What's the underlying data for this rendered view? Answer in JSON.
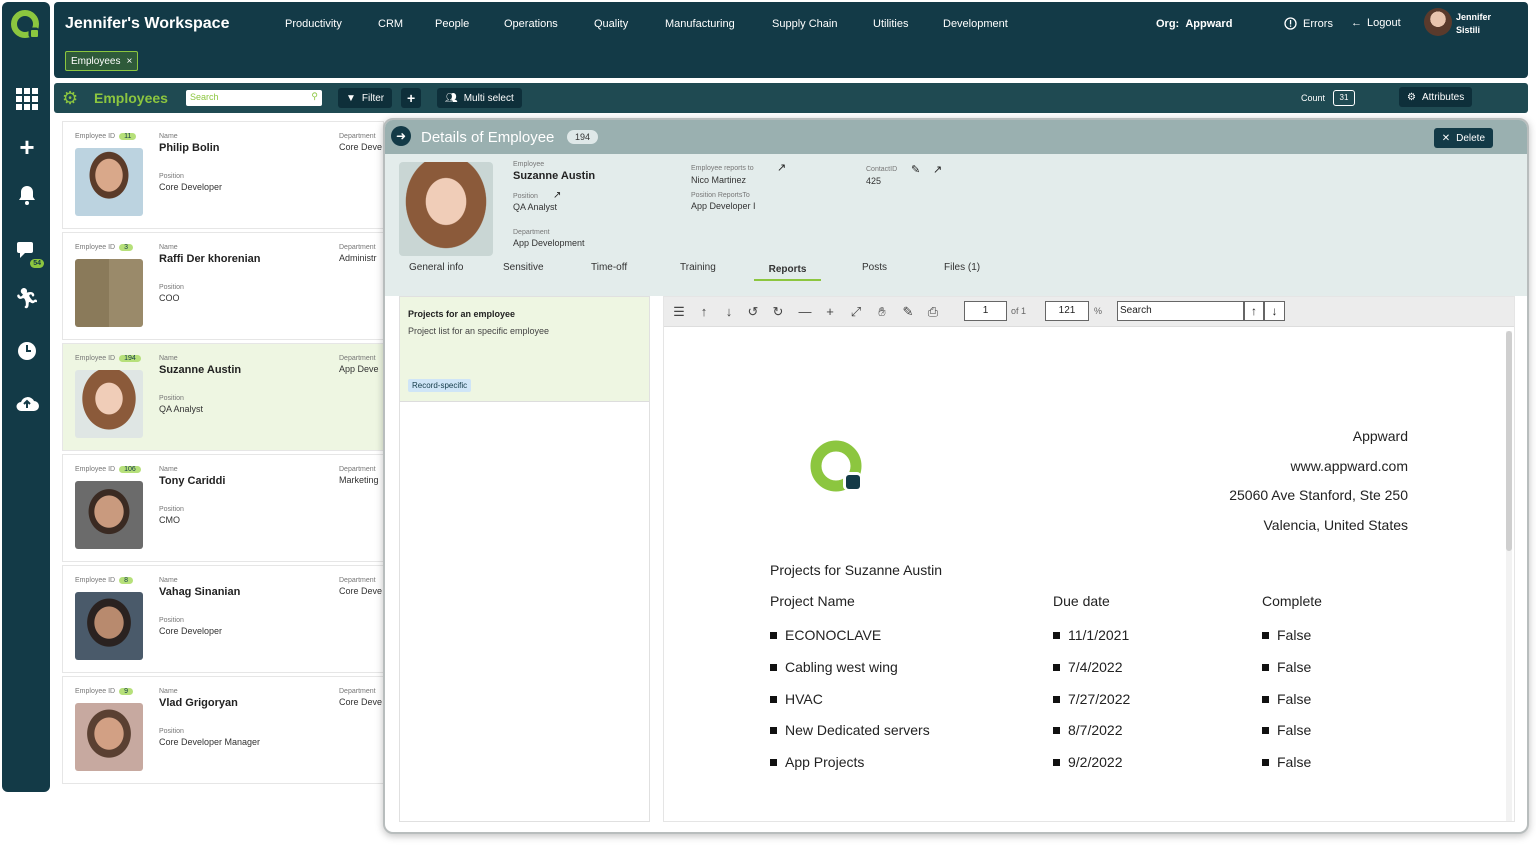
{
  "topbar": {
    "workspace_title": "Jennifer's Workspace",
    "nav": [
      "Productivity",
      "CRM",
      "People",
      "Operations",
      "Quality",
      "Manufacturing",
      "Supply Chain",
      "Utilities",
      "Development"
    ],
    "org_label": "Org:",
    "org_value": "Appward",
    "errors_label": "Errors",
    "logout_label": "Logout",
    "user_first": "Jennifer",
    "user_last": "Sistili",
    "open_tab": "Employees"
  },
  "rail": {
    "chat_badge": "54"
  },
  "toolbar": {
    "title": "Employees",
    "search_placeholder": "Search",
    "filter_label": "Filter",
    "multiselect_label": "Multi select",
    "count_label": "Count",
    "count_value": "31",
    "attributes_label": "Attributes"
  },
  "labels": {
    "employee_id": "Employee ID",
    "name": "Name",
    "position": "Position",
    "department": "Department"
  },
  "employees": [
    {
      "id": "11",
      "name": "Philip Bolin",
      "position": "Core Developer",
      "department": "Core Deve"
    },
    {
      "id": "3",
      "name": "Raffi Der khorenian",
      "position": "COO",
      "department": "Administr"
    },
    {
      "id": "194",
      "name": "Suzanne Austin",
      "position": "QA Analyst",
      "department": "App Deve"
    },
    {
      "id": "106",
      "name": "Tony Cariddi",
      "position": "CMO",
      "department": "Marketing"
    },
    {
      "id": "8",
      "name": "Vahag Sinanian",
      "position": "Core Developer",
      "department": "Core Deve"
    },
    {
      "id": "9",
      "name": "Vlad Grigoryan",
      "position": "Core Developer Manager",
      "department": "Core Deve"
    }
  ],
  "details": {
    "title": "Details of Employee",
    "id_badge": "194",
    "delete_label": "Delete",
    "employee_label": "Employee",
    "employee_name": "Suzanne Austin",
    "position_label": "Position",
    "position_value": "QA Analyst",
    "department_label": "Department",
    "department_value": "App Development",
    "reports_to_label": "Employee reports to",
    "reports_to_value": "Nico Martinez",
    "position_reports_label": "Position ReportsTo",
    "position_reports_value": "App Developer I",
    "contact_label": "ContactID",
    "contact_value": "425",
    "tabs": [
      "General info",
      "Sensitive",
      "Time-off",
      "Training",
      "Reports",
      "Posts",
      "Files (1)"
    ],
    "active_tab": "Reports"
  },
  "report_list": {
    "title": "Projects for an employee",
    "subtitle": "Project list for an specific employee",
    "tag": "Record-specific"
  },
  "viewer": {
    "page": "1",
    "of_label": "of 1",
    "zoom": "121",
    "zoom_unit": "%",
    "search_value": "Search"
  },
  "document": {
    "company": "Appward",
    "website": "www.appward.com",
    "address1": "25060 Ave Stanford, Ste 250",
    "address2": "Valencia, United States",
    "heading": "Projects for Suzanne Austin",
    "columns": [
      "Project Name",
      "Due date",
      "Complete"
    ],
    "rows": [
      {
        "name": "ECONOCLAVE",
        "due": "11/1/2021",
        "complete": "False"
      },
      {
        "name": "Cabling west wing",
        "due": "7/4/2022",
        "complete": "False"
      },
      {
        "name": "HVAC",
        "due": "7/27/2022",
        "complete": "False"
      },
      {
        "name": "New Dedicated servers",
        "due": "8/7/2022",
        "complete": "False"
      },
      {
        "name": "App Projects",
        "due": "9/2/2022",
        "complete": "False"
      }
    ]
  },
  "colors": {
    "navy": "#133a47",
    "green": "#8cc63f"
  }
}
